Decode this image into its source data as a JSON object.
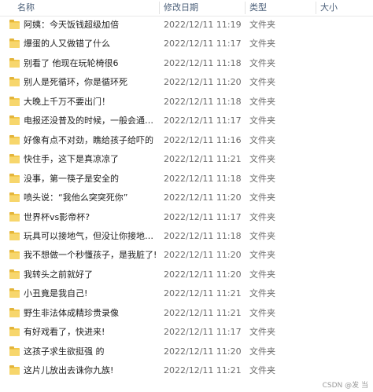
{
  "columns": {
    "name": "名称",
    "modified": "修改日期",
    "type": "类型",
    "size": "大小"
  },
  "files": [
    {
      "name": "阿姨：今天饭钱超级加倍",
      "modified": "2022/12/11 11:19",
      "type": "文件夹"
    },
    {
      "name": "爆蛋的人又做错了什么",
      "modified": "2022/12/11 11:17",
      "type": "文件夹"
    },
    {
      "name": "别看了 他现在玩轮椅很6",
      "modified": "2022/12/11 11:18",
      "type": "文件夹"
    },
    {
      "name": "别人是死循环，你是循环死",
      "modified": "2022/12/11 11:20",
      "type": "文件夹"
    },
    {
      "name": "大晚上千万不要出门！",
      "modified": "2022/12/11 11:18",
      "type": "文件夹"
    },
    {
      "name": "电报还没普及的时候，一般会通过训练黑…",
      "modified": "2022/12/11 11:17",
      "type": "文件夹"
    },
    {
      "name": "好像有点不对劲，瞧给孩子给吓的",
      "modified": "2022/12/11 11:16",
      "type": "文件夹"
    },
    {
      "name": "快住手，这下是真凉凉了",
      "modified": "2022/12/11 11:21",
      "type": "文件夹"
    },
    {
      "name": "没事，第一筷子是安全的",
      "modified": "2022/12/11 11:18",
      "type": "文件夹"
    },
    {
      "name": "喷头说：“我他么突突死你”",
      "modified": "2022/12/11 11:20",
      "type": "文件夹"
    },
    {
      "name": "世界杯vs影帝杯?",
      "modified": "2022/12/11 11:17",
      "type": "文件夹"
    },
    {
      "name": "玩具可以接地气，但没让你接地府啊",
      "modified": "2022/12/11 11:18",
      "type": "文件夹"
    },
    {
      "name": "我不想做一个秒懂孩子，是我脏了!",
      "modified": "2022/12/11 11:20",
      "type": "文件夹"
    },
    {
      "name": "我转头之前就好了",
      "modified": "2022/12/11 11:20",
      "type": "文件夹"
    },
    {
      "name": "小丑竟是我自己!",
      "modified": "2022/12/11 11:21",
      "type": "文件夹"
    },
    {
      "name": "野生非法体成精珍贵录像",
      "modified": "2022/12/11 11:21",
      "type": "文件夹"
    },
    {
      "name": "有好戏看了，快进来!",
      "modified": "2022/12/11 11:17",
      "type": "文件夹"
    },
    {
      "name": "这孩子求生欲挺强 的",
      "modified": "2022/12/11 11:20",
      "type": "文件夹"
    },
    {
      "name": "这片儿放出去诛你九族!",
      "modified": "2022/12/11 11:21",
      "type": "文件夹"
    }
  ],
  "watermark": "CSDN @发 当",
  "colors": {
    "header_text": "#4c607a",
    "folder_yellow": "#f2c94c",
    "meta_text": "#6a6a6a"
  },
  "icons": {
    "folder": "folder-icon"
  }
}
